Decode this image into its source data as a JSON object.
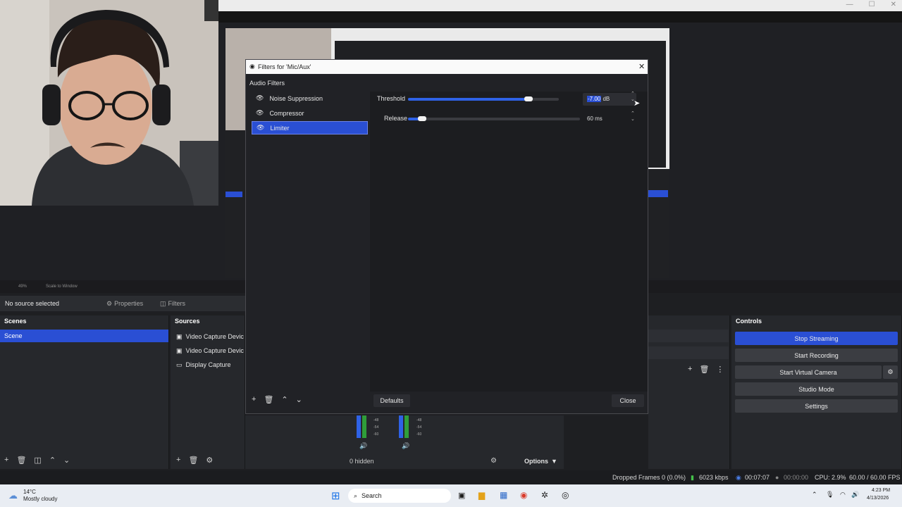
{
  "dialog": {
    "title": "Filters for 'Mic/Aux'",
    "section_label": "Audio Filters",
    "filters": [
      {
        "label": "Noise Suppression",
        "selected": false
      },
      {
        "label": "Compressor",
        "selected": false
      },
      {
        "label": "Limiter",
        "selected": true
      }
    ],
    "properties": {
      "threshold": {
        "label": "Threshold",
        "value": "-7.00 dB",
        "value_selected": "-7.00",
        "unit": "dB",
        "level": 0.8
      },
      "release": {
        "label": "Release",
        "value": "60 ms",
        "level": 0.08
      }
    },
    "defaults_label": "Defaults",
    "close_label": "Close"
  },
  "main": {
    "no_source": "No source selected",
    "properties_label": "Properties",
    "filters_label": "Filters",
    "preview_zoom": "49%",
    "scale_mode": "Scale to Window",
    "scenes": {
      "title": "Scenes",
      "items": [
        "Scene"
      ]
    },
    "sources": {
      "title": "Sources",
      "items": [
        {
          "label": "Video Capture Devic",
          "icon": "camera-icon"
        },
        {
          "label": "Video Capture Devic",
          "icon": "camera-icon"
        },
        {
          "label": "Display Capture",
          "icon": "monitor-icon"
        }
      ]
    },
    "mixer": {
      "hidden": "0 hidden",
      "options": "Options",
      "meter_ticks": [
        "-48",
        "-54",
        "-60"
      ]
    },
    "controls": {
      "title": "Controls",
      "buttons": [
        "Stop Streaming",
        "Start Recording",
        "Start Virtual Camera",
        "Studio Mode",
        "Settings"
      ]
    }
  },
  "status": {
    "dropped": "Dropped Frames 0 (0.0%)",
    "bitrate": "6023 kbps",
    "stream_time": "00:07:07",
    "rec_time": "00:00:00",
    "cpu": "CPU: 2.9%",
    "fps": "60.00 / 60.00 FPS"
  },
  "taskbar": {
    "weather_temp": "14°C",
    "weather_desc": "Mostly cloudy",
    "search": "Search",
    "time": "4:23 PM",
    "date": "4/13/2026"
  },
  "colors": {
    "accent": "#2a4fd4",
    "dialog_bg": "#212226"
  }
}
